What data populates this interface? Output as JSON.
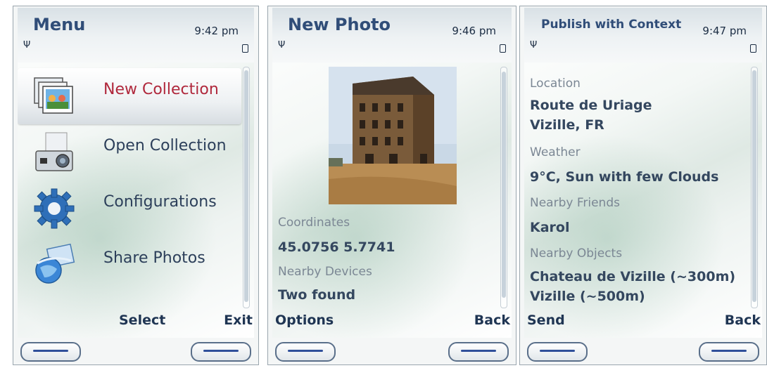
{
  "panels": [
    {
      "title": "Menu",
      "time": "9:42 pm",
      "items": [
        {
          "label": "New Collection",
          "icon": "photo-stack-icon",
          "selected": true
        },
        {
          "label": "Open Collection",
          "icon": "camera-icon",
          "selected": false
        },
        {
          "label": "Configurations",
          "icon": "gear-icon",
          "selected": false
        },
        {
          "label": "Share Photos",
          "icon": "globe-share-icon",
          "selected": false
        }
      ],
      "softkeys": {
        "left": "Select",
        "right": "Exit"
      }
    },
    {
      "title": "New Photo",
      "time": "9:46 pm",
      "fields": [
        {
          "label": "Coordinates",
          "value": "45.0756 5.7741"
        },
        {
          "label": "Nearby Devices",
          "value": "Two found"
        }
      ],
      "softkeys": {
        "left": "Options",
        "right": "Back"
      }
    },
    {
      "title": "Publish with Context",
      "time": "9:47 pm",
      "location": {
        "label": "Location",
        "line1": "Route de Uriage",
        "line2": "Vizille, FR"
      },
      "weather": {
        "label": "Weather",
        "value": "9°C, Sun with few Clouds"
      },
      "friends": {
        "label": "Nearby Friends",
        "value": "Karol"
      },
      "objects": {
        "label": "Nearby Objects",
        "line1": "Chateau de Vizille (~300m)",
        "line2": "Vizille (~500m)"
      },
      "softkeys": {
        "left": "Send",
        "right": "Back"
      }
    }
  ],
  "colors": {
    "title": "#304d78",
    "selected": "#b0283c",
    "text": "#2c3f5a",
    "label": "#7b8794"
  }
}
